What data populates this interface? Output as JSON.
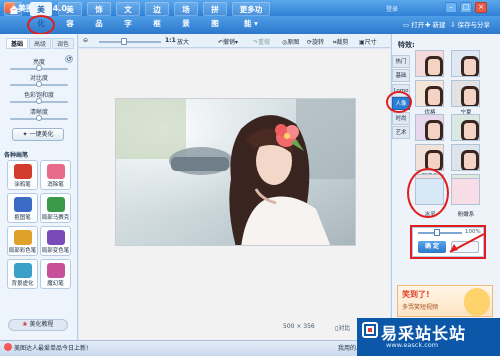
{
  "app": {
    "title": "美图秀秀 4.0",
    "user_link": "登录",
    "minimize": "–",
    "maximize": "□",
    "close": "×"
  },
  "menu": {
    "home_icon": "home-icon",
    "tabs": [
      "美化",
      "美容",
      "饰品",
      "文字",
      "边框",
      "场景",
      "拼图",
      "更多功能"
    ],
    "active_tab": "美化",
    "right": {
      "open": "打开",
      "new": "新建",
      "save": "保存与分享"
    }
  },
  "left_panel": {
    "subtabs": [
      "基础",
      "高级",
      "调色"
    ],
    "sliders": [
      {
        "label": "亮度",
        "level": 0.5
      },
      {
        "label": "对比度",
        "level": 0.5
      },
      {
        "label": "色彩饱和度",
        "level": 0.5
      },
      {
        "label": "清晰度",
        "level": 0.5
      }
    ],
    "one_click": "一键美化",
    "brush_header": "各种画笔",
    "brushes": [
      {
        "label": "涂鸦笔",
        "color": "#d33b2c"
      },
      {
        "label": "消除笔",
        "color": "#e86b8c"
      },
      {
        "label": "抠图笔",
        "color": "#3b6bc4"
      },
      {
        "label": "局部马赛克",
        "color": "#3b9a4a"
      },
      {
        "label": "局部彩色笔",
        "color": "#e0a12a"
      },
      {
        "label": "局部变色笔",
        "color": "#7a4bb8"
      },
      {
        "label": "背景虚化",
        "color": "#3aa0c8"
      },
      {
        "label": "魔幻笔",
        "color": "#c8509a"
      }
    ],
    "tutorial": "美化教程"
  },
  "canvas_toolbar": {
    "zoom_ratio": "1:1",
    "zoom_in": "放大",
    "undo": "撤销",
    "redo": "重做",
    "original": "原图",
    "rotate": "旋转",
    "crop": "裁剪",
    "size": "尺寸"
  },
  "canvas": {
    "width": "500",
    "height": "356",
    "compare": "对比",
    "preview": "预览"
  },
  "right_panel": {
    "title": "特效",
    "categories": [
      "热门",
      "基础",
      "Lomo",
      "人像",
      "时尚",
      "艺术"
    ],
    "active_category": "人像",
    "effects": [
      "",
      "",
      "优格",
      "宁夏",
      "",
      "",
      "阿宝色",
      "",
      "",
      "",
      "",
      "",
      "冰灵",
      "粉嫩系"
    ],
    "opacity": "100%",
    "confirm": "确 定",
    "cancel": ""
  },
  "ad": {
    "line1": "笑到了!",
    "line2": "多骂笑短视频"
  },
  "status": {
    "text": "美图达人最爱单品今日上新!",
    "right": "我用的..."
  },
  "watermark": {
    "main": "易采站长站",
    "sub": "www.easck.com"
  },
  "colors": {
    "accent": "#2c78cc",
    "annotation": "#e01e1e"
  }
}
